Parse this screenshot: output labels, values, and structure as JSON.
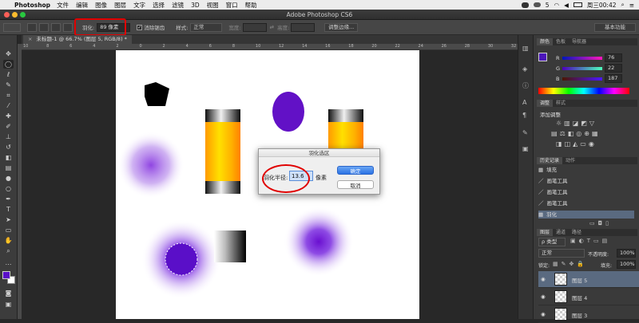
{
  "menubar": {
    "app_name": "Photoshop",
    "items": [
      "文件",
      "编辑",
      "图像",
      "图层",
      "文字",
      "选择",
      "滤镜",
      "3D",
      "视图",
      "窗口",
      "帮助"
    ],
    "status_text": "5",
    "clock": "周三00:42"
  },
  "window": {
    "title": "Adobe Photoshop CS6"
  },
  "options_bar": {
    "feather_label": "羽化:",
    "feather_value": "89 像素",
    "antialias_label": "消除锯齿",
    "style_label": "样式:",
    "style_value": "正常",
    "width_label": "宽度:",
    "height_label": "高度:",
    "refine_button": "调整边缘...",
    "workspace_value": "基本功能"
  },
  "document": {
    "tab_label": "未标题-1 @ 66.7% (图层 5, RGB/8) *"
  },
  "ruler": {
    "ticks": [
      "10",
      "8",
      "6",
      "4",
      "2",
      "0",
      "2",
      "4",
      "6",
      "8",
      "10",
      "12",
      "14",
      "16",
      "18",
      "20",
      "22",
      "24",
      "26",
      "28",
      "30",
      "32"
    ]
  },
  "dialog": {
    "title": "羽化选区",
    "radius_label": "羽化半径:",
    "radius_value": "13.6",
    "unit": "像素",
    "ok_button": "确定",
    "cancel_button": "取消"
  },
  "color_panel": {
    "tabs": [
      "颜色",
      "色板",
      "导航器"
    ],
    "r_label": "R",
    "r_value": "76",
    "g_label": "G",
    "g_value": "22",
    "b_label": "B",
    "b_value": "187",
    "fg_color": "#4c16bb"
  },
  "adjust_panel": {
    "tabs": [
      "调整",
      "样式"
    ],
    "add_label": "添加调整"
  },
  "history_panel": {
    "tabs": [
      "历史记录",
      "动作"
    ],
    "items": [
      "填充",
      "画笔工具",
      "画笔工具",
      "画笔工具",
      "羽化"
    ]
  },
  "layers_panel": {
    "tabs": [
      "图层",
      "通道",
      "路径"
    ],
    "kind_label": "ρ 类型",
    "blend_value": "正常",
    "opacity_label": "不透明度:",
    "opacity_value": "100%",
    "lock_label": "锁定:",
    "fill_label": "填充:",
    "fill_value": "100%",
    "layers": [
      "图层 5",
      "图层 4",
      "图层 3"
    ]
  },
  "colors": {
    "accent_purple": "#5a0fc8",
    "highlight_red": "#e00000",
    "panel_bg": "#3a3a3a"
  }
}
